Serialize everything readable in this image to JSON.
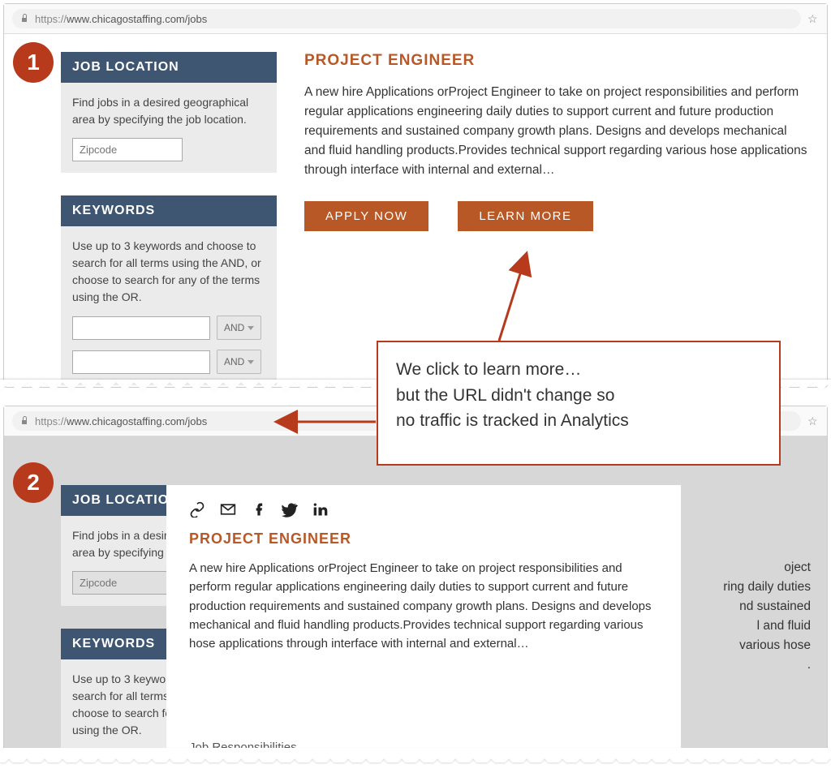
{
  "url": {
    "secure_scheme": "https://",
    "rest": "www.chicagostaffing.com/jobs"
  },
  "sidebar": {
    "location": {
      "title": "JOB LOCATION",
      "desc": "Find jobs in a desired geographical area by specifying the job location.",
      "placeholder": "Zipcode"
    },
    "keywords": {
      "title": "KEYWORDS",
      "desc": "Use up to 3 keywords and choose to search for all terms using the AND, or choose to search for any of the terms using the OR.",
      "and_label": "AND"
    }
  },
  "job": {
    "title": "PROJECT ENGINEER",
    "description": "A new hire Applications orProject Engineer to take on project responsibilities and perform regular applications engineering daily duties to support current and future production requirements and sustained company growth plans. Designs and develops mechanical and fluid handling products.Provides technical support regarding various hose applications through interface with internal and external…",
    "apply_label": "APPLY NOW",
    "learn_label": "LEARN MORE"
  },
  "modal": {
    "title": "PROJECT ENGINEER",
    "description": "A new hire Applications orProject Engineer to take on project responsibilities and perform regular applications engineering daily duties to support current and future production requirements and sustained company growth plans. Designs and develops mechanical and fluid handling products.Provides technical support regarding various hose applications through interface with internal and external…",
    "section": "Job Responsibilities"
  },
  "bg": {
    "desc_fragment": "oject ring daily duties nd sustained l and fluid various hose"
  },
  "callout": {
    "line1": "We click to learn more…",
    "line2": "but the URL didn't change so",
    "line3": "no traffic is tracked in Analytics"
  },
  "badges": {
    "one": "1",
    "two": "2"
  },
  "star": "☆"
}
